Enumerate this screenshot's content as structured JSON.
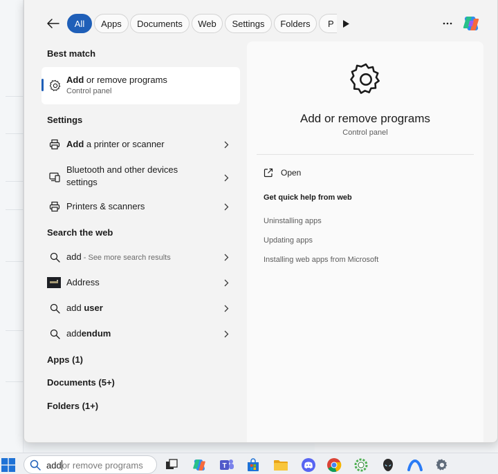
{
  "filters": {
    "back_label": "Back",
    "chips": [
      "All",
      "Apps",
      "Documents",
      "Web",
      "Settings",
      "Folders",
      "P"
    ],
    "active": "All"
  },
  "best_match": {
    "section": "Best match",
    "title_bold": "Add",
    "title_rest": " or remove programs",
    "subtitle": "Control panel"
  },
  "settings": {
    "section": "Settings",
    "items": [
      {
        "bold": "Add",
        "rest": " a printer or scanner",
        "icon": "printer-icon"
      },
      {
        "bold": "",
        "rest": "Bluetooth and other devices settings",
        "icon": "devices-icon"
      },
      {
        "bold": "",
        "rest": "Printers & scanners",
        "icon": "printer-icon"
      }
    ]
  },
  "web": {
    "section": "Search the web",
    "items": [
      {
        "main": "add",
        "dim": " - See more search results",
        "icon": "search-icon"
      },
      {
        "main": "Address",
        "bold": "",
        "icon": "thumbnail-image"
      },
      {
        "main": "add",
        "bold": " user",
        "icon": "search-icon"
      },
      {
        "main": "add",
        "bold": "endum",
        "icon": "search-icon"
      }
    ]
  },
  "categories": [
    "Apps (1)",
    "Documents (5+)",
    "Folders (1+)"
  ],
  "detail": {
    "title": "Add or remove programs",
    "subtitle": "Control panel",
    "open_label": "Open",
    "help_title": "Get quick help from web",
    "help_links": [
      "Uninstalling apps",
      "Updating apps",
      "Installing web apps from Microsoft"
    ]
  },
  "taskbar": {
    "search_typed": "add",
    "search_ghost": "or remove programs",
    "apps": [
      "task-view-icon",
      "copilot-icon",
      "teams-icon",
      "store-icon",
      "file-explorer-icon",
      "discord-icon",
      "chrome-icon",
      "app-ring-icon",
      "alienware-icon",
      "arc-icon",
      "settings-icon"
    ]
  },
  "colors": {
    "accent": "#1f5fb8",
    "panel": "#f3f3f3",
    "detail": "#fafafa"
  }
}
